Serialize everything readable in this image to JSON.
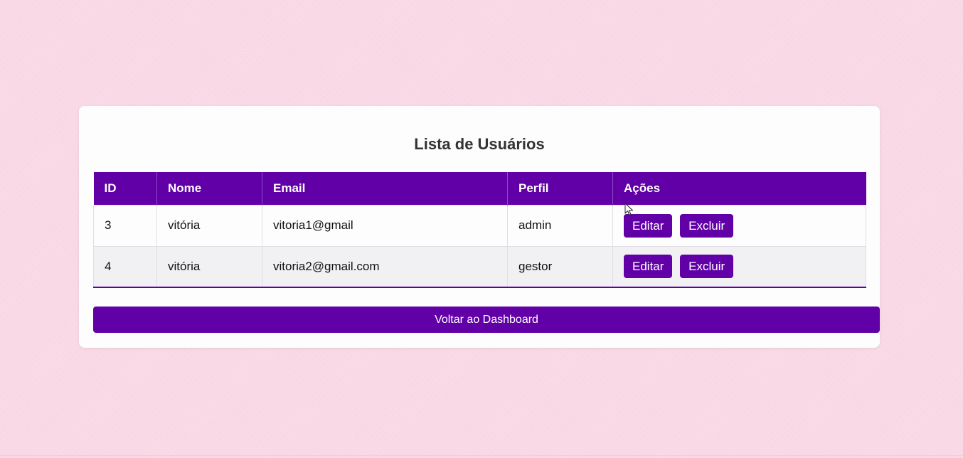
{
  "page": {
    "title": "Lista de Usuários",
    "back_button_label": "Voltar ao Dashboard"
  },
  "table": {
    "headers": {
      "id": "ID",
      "nome": "Nome",
      "email": "Email",
      "perfil": "Perfil",
      "acoes": "Ações"
    },
    "rows": [
      {
        "id": "3",
        "nome": "vitória",
        "email": "vitoria1@gmail",
        "perfil": "admin",
        "edit_label": "Editar",
        "delete_label": "Excluir"
      },
      {
        "id": "4",
        "nome": "vitória",
        "email": "vitoria2@gmail.com",
        "perfil": "gestor",
        "edit_label": "Editar",
        "delete_label": "Excluir"
      }
    ]
  },
  "icons": {
    "cursor": "mouse-pointer-icon"
  },
  "colors": {
    "accent": "#6200a8",
    "background": "#fad9e6",
    "card": "#fefdfe",
    "title": "#333333",
    "row_alt": "#f1f0f2"
  }
}
